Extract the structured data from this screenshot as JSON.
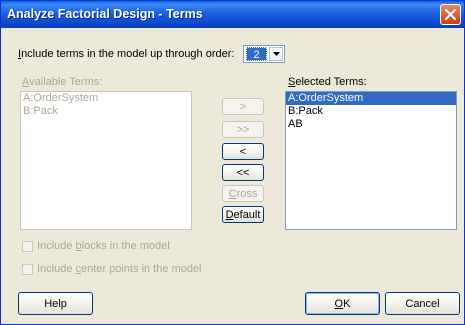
{
  "window": {
    "title": "Analyze Factorial Design - Terms"
  },
  "order": {
    "label_prefix": "I",
    "label_rest": "nclude terms in the model up through order:",
    "value": "2"
  },
  "available": {
    "label_prefix": "A",
    "label_rest": "vailable Terms:",
    "items": [
      "A:OrderSystem",
      "B:Pack"
    ]
  },
  "selected": {
    "label_prefix": "S",
    "label_rest": "elected Terms:",
    "items": [
      "A:OrderSystem",
      "B:Pack",
      "AB"
    ]
  },
  "buttons": {
    "add": ">",
    "add_all": ">>",
    "remove": "<",
    "remove_all": "<<",
    "cross": "Cross",
    "cross_prefix": "C",
    "cross_rest": "ross",
    "default_prefix": "D",
    "default_rest": "efault",
    "help": "Help",
    "ok_prefix": "O",
    "ok_rest": "K",
    "cancel": "Cancel"
  },
  "options": {
    "blocks_pre": "Include ",
    "blocks_key": "b",
    "blocks_post": "locks in the model",
    "center_pre": "Include ",
    "center_key": "c",
    "center_post": "enter points in the model"
  }
}
